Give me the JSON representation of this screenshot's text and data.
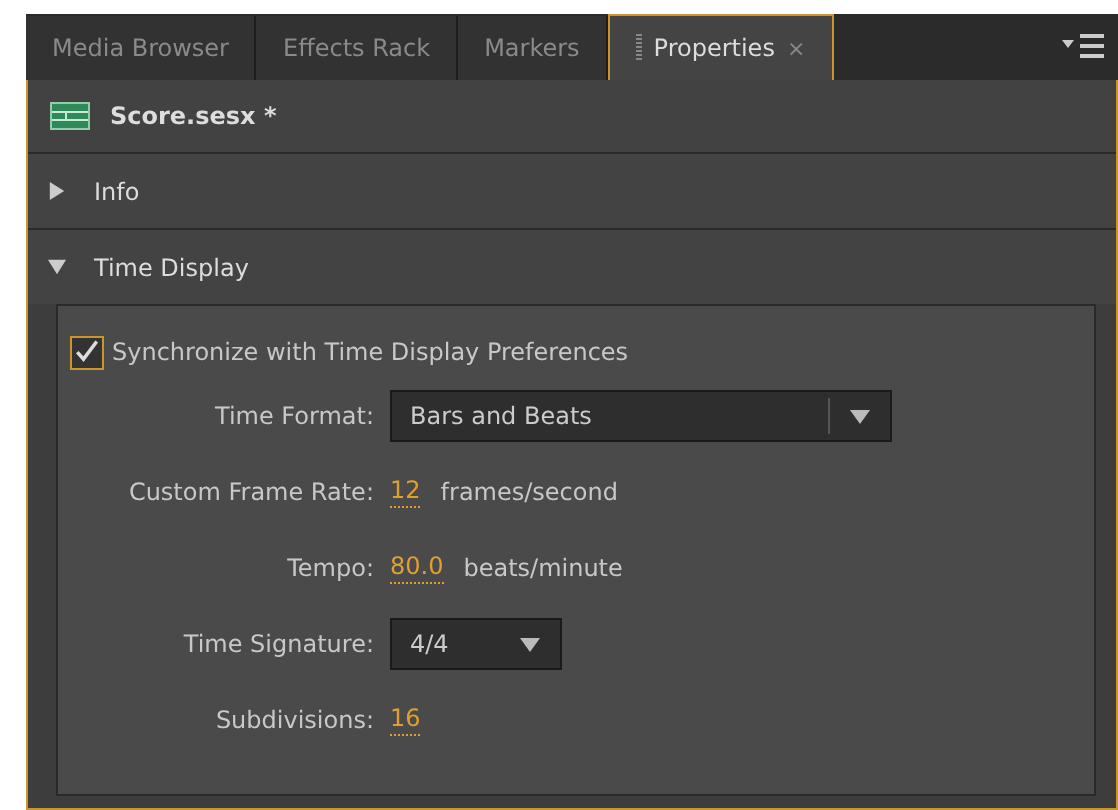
{
  "tabs": [
    {
      "label": "Media Browser",
      "selected": false
    },
    {
      "label": "Effects Rack",
      "selected": false
    },
    {
      "label": "Markers",
      "selected": false
    },
    {
      "label": "Properties",
      "selected": true,
      "close": "×"
    }
  ],
  "file": {
    "title": "Score.sesx *"
  },
  "sections": [
    {
      "title": "Info",
      "expanded": false
    },
    {
      "title": "Time Display",
      "expanded": true
    }
  ],
  "sync": {
    "label": "Synchronize with Time Display Preferences",
    "checked": true
  },
  "fields": [
    {
      "kind": "dropdown",
      "label": "Time Format:",
      "value": "Bars and Beats",
      "wide": true
    },
    {
      "kind": "scrub",
      "label": "Custom Frame Rate:",
      "value": "12",
      "unit": "frames/second"
    },
    {
      "kind": "scrub",
      "label": "Tempo:",
      "value": "80.0",
      "unit": "beats/minute"
    },
    {
      "kind": "dropdown",
      "label": "Time Signature:",
      "value": "4/4",
      "wide": false
    },
    {
      "kind": "scrub",
      "label": "Subdivisions:",
      "value": "16"
    }
  ]
}
